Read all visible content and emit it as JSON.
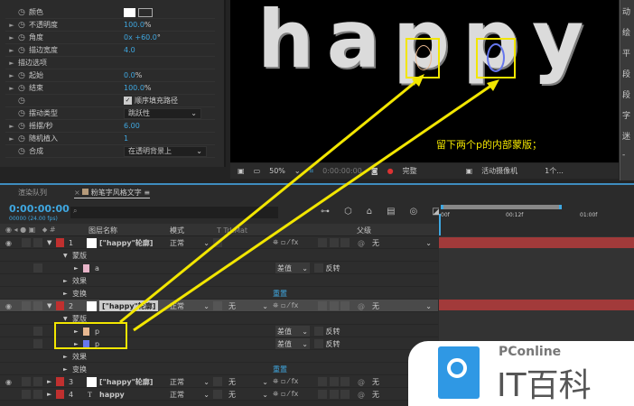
{
  "effects": {
    "rows": [
      {
        "label": "颜色",
        "value": "",
        "expand": false
      },
      {
        "label": "不透明度",
        "value": "100.0",
        "unit": "%",
        "expand": true
      },
      {
        "label": "角度",
        "value": "0x +60.0",
        "unit": "°",
        "expand": true
      },
      {
        "label": "描边宽度",
        "value": "4.0",
        "unit": "",
        "expand": true
      },
      {
        "label": "描边选项",
        "value": "",
        "expand": true,
        "group": true
      },
      {
        "label": "起始",
        "value": "0.0",
        "unit": "%",
        "expand": true
      },
      {
        "label": "结束",
        "value": "100.0",
        "unit": "%",
        "expand": true
      },
      {
        "label": "",
        "value": "",
        "expand": false
      },
      {
        "label": "摆动类型",
        "value": "",
        "expand": false
      },
      {
        "label": "摇摆/秒",
        "value": "6.00",
        "unit": "",
        "expand": true
      },
      {
        "label": "随机植入",
        "value": "1",
        "unit": "",
        "expand": true
      },
      {
        "label": "合成",
        "value": "",
        "expand": false
      }
    ],
    "checkbox_label": "顺序填充路径",
    "wiggle_type": "跳跃性",
    "composite": "在透明背景上"
  },
  "viewer": {
    "letters": "happy",
    "annotation": "留下两个p的内部蒙版；",
    "zoom": "50%",
    "timecode": "0:00:00:00",
    "quality": "完整",
    "camera": "活动摄像机",
    "views": "1个..."
  },
  "right_panel": [
    "动",
    "绘",
    "平",
    "段",
    "段",
    "字",
    "迷",
    "-"
  ],
  "timeline": {
    "tabs": [
      "渲染队列",
      "粉笔字风格文字"
    ],
    "timecode": "0:00:00:00",
    "timecode_sub": "00000 (24.00 fps)",
    "columns": {
      "name": "图层名称",
      "mode": "模式",
      "trkmat": "T  TrkMat",
      "parent": "父级"
    },
    "ruler": [
      "00f",
      "00:12f",
      "01:00f"
    ],
    "layers": [
      {
        "num": "1",
        "name": "[\"happy\"轮廓]",
        "mode": "正常",
        "trk": "",
        "parent": "无",
        "open": true,
        "masks": [
          {
            "name": "a",
            "color": "#e8b4c8",
            "mode": "差值",
            "invert": "反转"
          }
        ]
      },
      {
        "num": "2",
        "name": "[\"happy\"轮廓]",
        "mode": "正常",
        "trk": "无",
        "parent": "无",
        "open": true,
        "masks": [
          {
            "name": "p",
            "color": "#e8b890",
            "mode": "差值",
            "invert": "反转"
          },
          {
            "name": "p",
            "color": "#6677ee",
            "mode": "差值",
            "invert": "反转"
          }
        ]
      },
      {
        "num": "3",
        "name": "[\"happy\"轮廓]",
        "mode": "正常",
        "trk": "无",
        "parent": "无"
      },
      {
        "num": "4",
        "name": "happy",
        "mode": "正常",
        "trk": "无",
        "parent": "无"
      }
    ],
    "mask_group": "蒙版",
    "effects_group": "效果",
    "transform_group": "变换",
    "reset": "重置"
  },
  "watermark": {
    "brand": "PConline",
    "name": "IT百科"
  }
}
